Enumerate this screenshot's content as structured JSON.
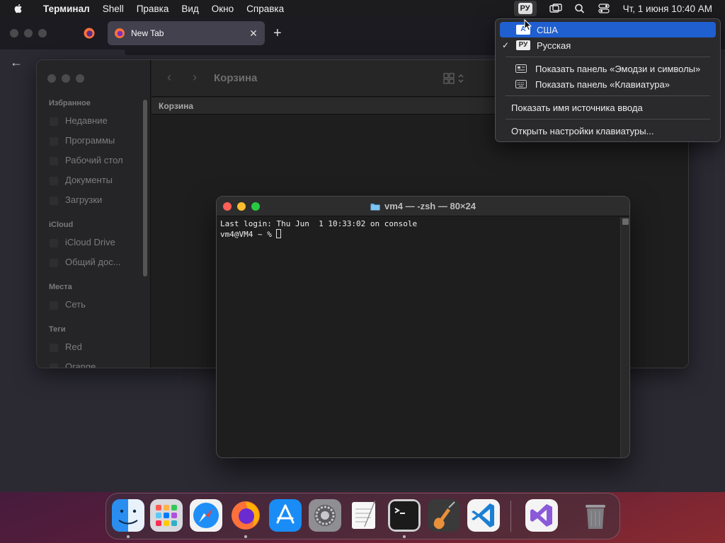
{
  "menubar": {
    "app_name": "Терминал",
    "items": [
      "Shell",
      "Правка",
      "Вид",
      "Окно",
      "Справка"
    ],
    "input_badge": "РУ",
    "clock": "Чт, 1 июня  10:40 AM"
  },
  "browser": {
    "tab_title": "New Tab",
    "tab_close": "✕",
    "new_tab": "+",
    "back": "←"
  },
  "finder": {
    "title": "Корзина",
    "path": "Корзина",
    "nav_back": "‹",
    "nav_forward": "›",
    "sidebar": {
      "favorites_header": "Избранное",
      "favorites": [
        "Недавние",
        "Программы",
        "Рабочий стол",
        "Документы",
        "Загрузки"
      ],
      "icloud_header": "iCloud",
      "icloud": [
        "iCloud Drive",
        "Общий дос..."
      ],
      "places_header": "Места",
      "places": [
        "Сеть"
      ],
      "tags_header": "Теги",
      "tags": [
        "Red",
        "Orange"
      ]
    }
  },
  "terminal": {
    "title": "vm4 — -zsh — 80×24",
    "line1": "Last login: Thu Jun  1 10:33:02 on console",
    "line2": "vm4@VM4 ~ % "
  },
  "input_menu": {
    "items": [
      {
        "badge": "A",
        "label": "США",
        "selected": true,
        "checked": false
      },
      {
        "badge": "РУ",
        "label": "Русская",
        "selected": false,
        "checked": true
      }
    ],
    "check_mark": "✓",
    "show_emoji": "Показать панель «Эмодзи и символы»",
    "show_keyboard": "Показать панель «Клавиатура»",
    "show_source_name": "Показать имя источника ввода",
    "open_keyboard_settings": "Открыть настройки клавиатуры..."
  },
  "dock": {
    "apps": [
      "Finder",
      "Launchpad",
      "Safari",
      "Firefox",
      "App Store",
      "System Settings",
      "TextEdit",
      "Terminal",
      "GarageBand",
      "Visual Studio Code",
      "Visual Studio",
      "Trash"
    ]
  },
  "colors": {
    "menu_highlight": "#1f5fd0",
    "traffic_red": "#ff5f57",
    "traffic_yellow": "#febc2e",
    "traffic_green": "#28c840"
  }
}
